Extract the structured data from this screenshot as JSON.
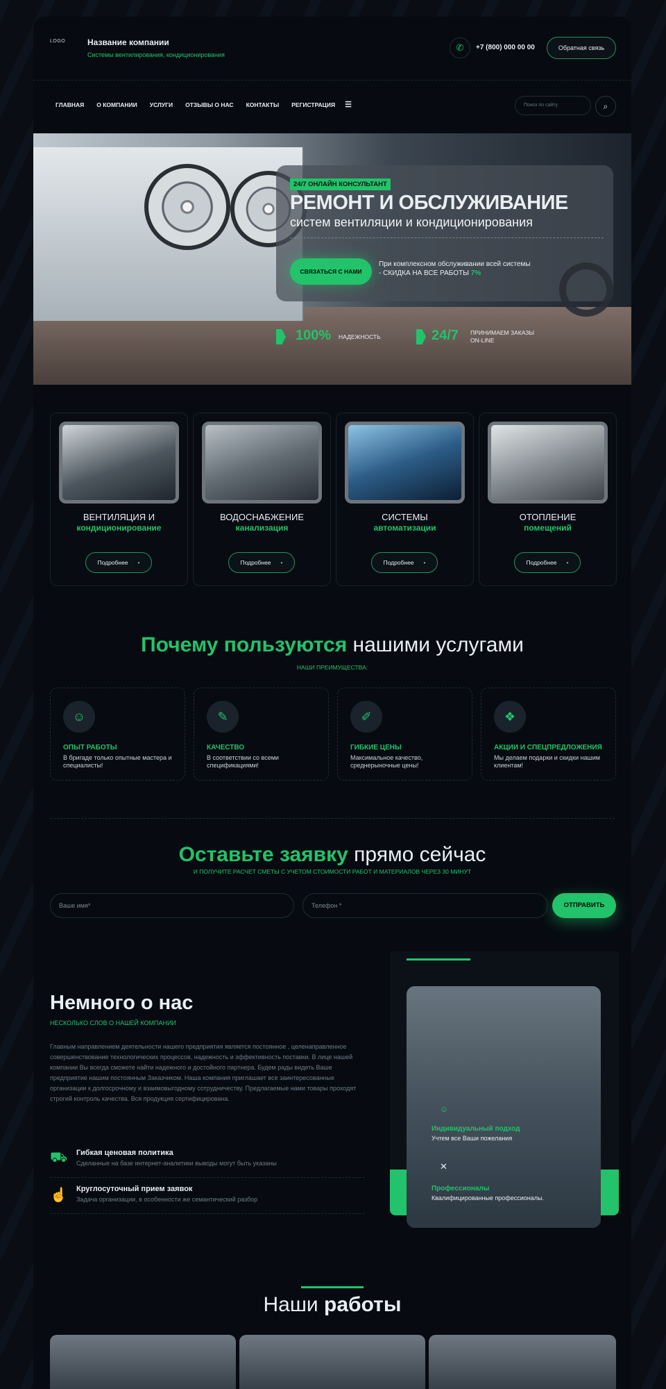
{
  "header": {
    "logo": "LOGO",
    "company_name": "Название компании",
    "company_sub": "Системы вентилирования, кондиционирования",
    "phone": "+7 (800) 000 00 00",
    "callback": "Обратная связь"
  },
  "nav": {
    "items": [
      "ГЛАВНАЯ",
      "О КОМПАНИИ",
      "УСЛУГИ",
      "ОТЗЫВЫ О НАС",
      "КОНТАКТЫ",
      "РЕГИСТРАЦИЯ"
    ],
    "search_placeholder": "Поиск по сайту"
  },
  "hero": {
    "badge": "24/7 ОНЛАЙН КОНСУЛЬТАНТ",
    "title": "РЕМОНТ И ОБСЛУЖИВАНИЕ",
    "subtitle": "систем вентиляции и кондиционирования",
    "button": "СВЯЗАТЬСЯ С НАМИ",
    "discount_text": "При комплексном обслуживании всей системы - СКИДКА НА ВСЕ РАБОТЫ",
    "discount_value": "7%",
    "stat1_value": "100%",
    "stat1_label": "НАДЕЖНОСТЬ",
    "stat2_value": "24/7",
    "stat2_label_1": "ПРИНИМАЕМ ЗАКАЗЫ",
    "stat2_label_2": "ON-LINE"
  },
  "services": [
    {
      "line1": "ВЕНТИЛЯЦИЯ И",
      "line2": "кондиционирование",
      "button": "Подробнее"
    },
    {
      "line1": "ВОДОСНАБЖЕНИЕ",
      "line2": "канализация",
      "button": "Подробнее"
    },
    {
      "line1": "СИСТЕМЫ",
      "line2": "автоматизации",
      "button": "Подробнее"
    },
    {
      "line1": "ОТОПЛЕНИЕ",
      "line2": "помещений",
      "button": "Подробнее"
    }
  ],
  "why": {
    "title_green": "Почему пользуются",
    "title_rest": "нашими услугами",
    "subtitle": "НАШИ ПРЕИМУЩЕСТВА:",
    "items": [
      {
        "title": "ОПЫТ РАБОТЫ",
        "text": "В бригаде только опытные мастера и специалисты!"
      },
      {
        "title": "КАЧЕСТВО",
        "text": "В соответствии со всеми спецификациями!"
      },
      {
        "title": "ГИБКИЕ ЦЕНЫ",
        "text": "Максимальное качество, среднерыночные цены!"
      },
      {
        "title": "АКЦИИ И СПЕЦПРЕДЛОЖЕНИЯ",
        "text": "Мы делаем подарки и скидки нашим клиентам!"
      }
    ]
  },
  "form": {
    "title_green": "Оставьте заявку",
    "title_rest": "прямо сейчас",
    "subtitle": "И ПОЛУЧИТЕ РАСЧЕТ СМЕТЫ С УЧЕТОМ СТОИМОСТИ РАБОТ И МАТЕРИАЛОВ ЧЕРЕЗ 30 МИНУТ",
    "name_placeholder": "Ваше имя*",
    "phone_placeholder": "Телефон *",
    "submit": "ОТПРАВИТЬ"
  },
  "about": {
    "title": "Немного о нас",
    "subtitle": "НЕСКОЛЬКО СЛОВ О НАШЕЙ КОМПАНИИ",
    "text": "Главным направлением деятельности нашего предприятия является постоянное , целенаправленное совершенствование технологических процессов, надежность и эффективность поставки. В лице нашей компании Вы всегда сможете найти надежного и достойного партнера. Будем рады видеть Ваше предприятие нашим постоянным Заказчиком. Наша компания приглашает все заинтересованные организации к долгосрочному и взаимовыгодному сотрудничеству. Предлагаемые нами товары проходят строгий контроль качества. Вся продукция сертифицирована.",
    "features": [
      {
        "title": "Гибкая ценовая политика",
        "text": "Сделанные на базе интернет-аналитики выводы могут быть указаны"
      },
      {
        "title": "Круглосуточный прием заявок",
        "text": "Задача организации, в особенности же семантический разбор"
      }
    ],
    "card1_title": "Индивидуальный подход",
    "card1_text": "Учтем все Ваши пожелания",
    "card2_title": "Профессионалы",
    "card2_text": "Квалифицированные профессионалы."
  },
  "works": {
    "title_regular": "Наши",
    "title_bold": "работы"
  }
}
